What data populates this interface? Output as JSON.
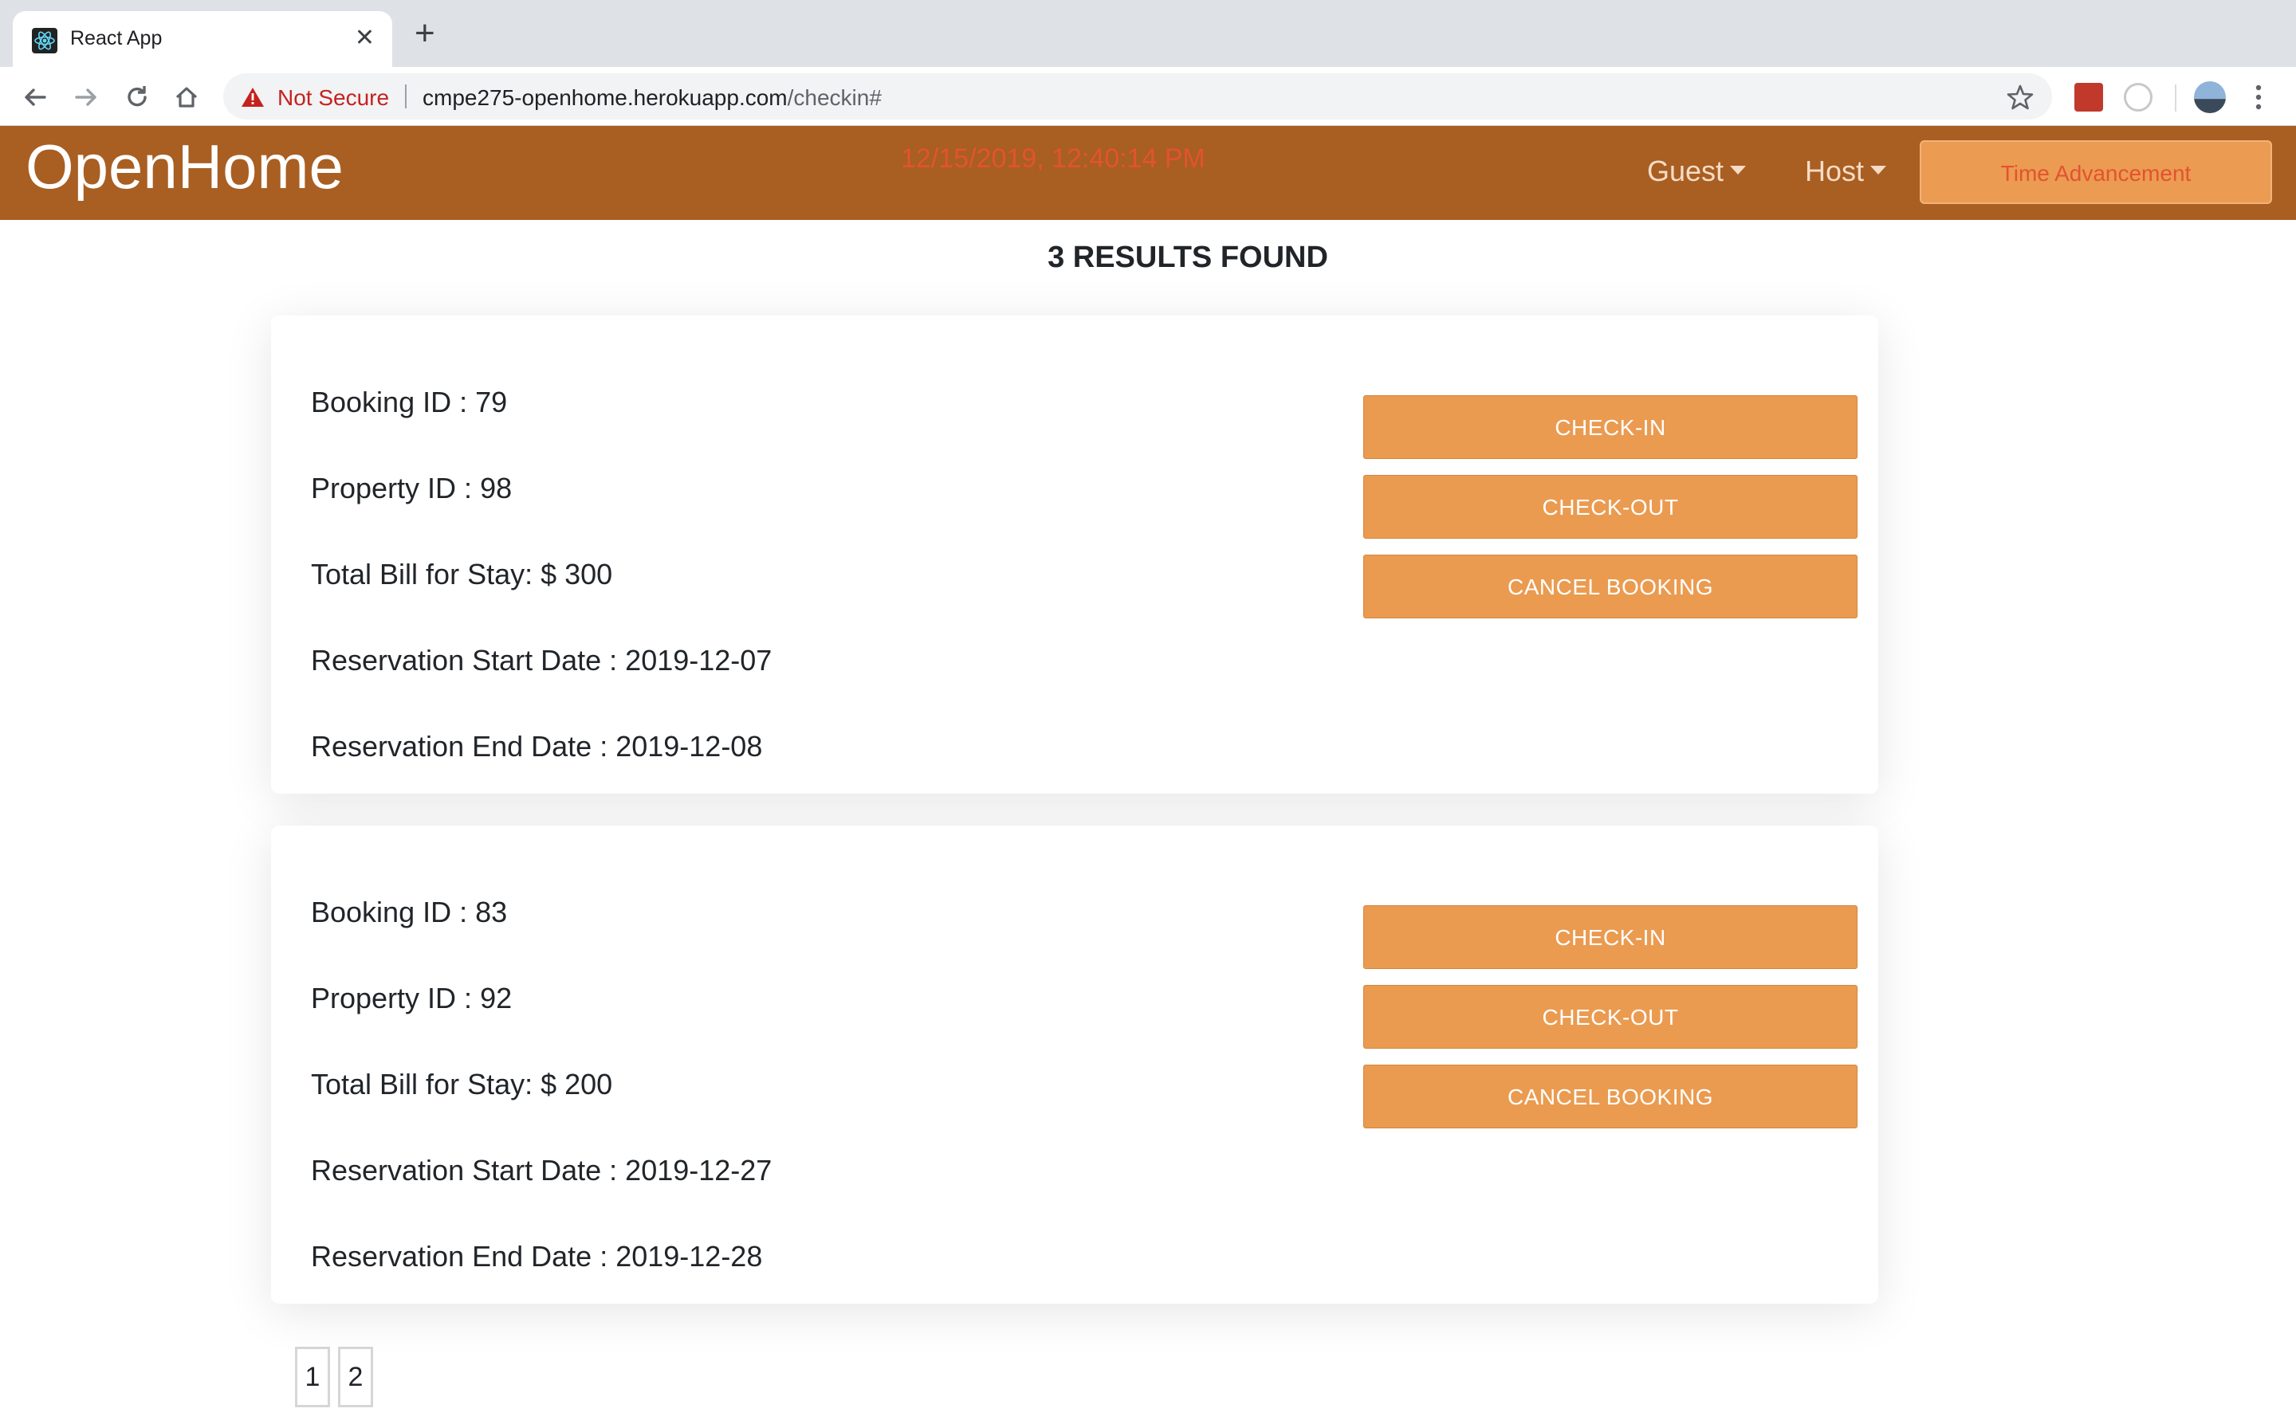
{
  "browser": {
    "tab_title": "React App",
    "tab_close": "✕",
    "new_tab": "+",
    "security_label": "Not Secure",
    "url_host": "cmpe275-openhome.herokuapp.com",
    "url_path": "/checkin#",
    "icons": [
      "back-icon",
      "forward-icon",
      "reload-icon",
      "home-icon",
      "warning-icon",
      "star-icon",
      "extension-icon",
      "profile-avatar",
      "menu-icon"
    ]
  },
  "navbar": {
    "brand": "OpenHome",
    "datetime": "12/15/2019, 12:40:14 PM",
    "guest_menu": "Guest",
    "host_menu": "Host",
    "time_button": "Time Advancement",
    "colors": {
      "navbar_bg": "#a95e22",
      "button_bg": "#ea9b50",
      "clock_text": "#e25330"
    }
  },
  "results": {
    "heading": "3 RESULTS FOUND",
    "bookings": [
      {
        "booking_id": "Booking ID : 79",
        "property_id": "Property ID : 98",
        "total_bill": "Total Bill for Stay: $ 300",
        "start_date": "Reservation Start Date : 2019-12-07",
        "end_date": "Reservation End Date : 2019-12-08",
        "checkin_label": "CHECK-IN",
        "checkout_label": "CHECK-OUT",
        "cancel_label": "CANCEL BOOKING"
      },
      {
        "booking_id": "Booking ID : 83",
        "property_id": "Property ID : 92",
        "total_bill": "Total Bill for Stay: $ 200",
        "start_date": "Reservation Start Date : 2019-12-27",
        "end_date": "Reservation End Date : 2019-12-28",
        "checkin_label": "CHECK-IN",
        "checkout_label": "CHECK-OUT",
        "cancel_label": "CANCEL BOOKING"
      }
    ]
  },
  "pagination": {
    "pages": [
      "1",
      "2"
    ]
  }
}
